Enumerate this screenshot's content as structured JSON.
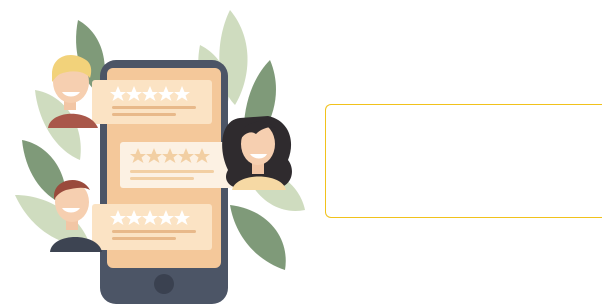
{
  "illustration": {
    "review_cards": [
      {
        "position": "top",
        "stars": 5,
        "reviewer": "blond-man"
      },
      {
        "position": "middle",
        "stars": 5,
        "reviewer": "curly-haired-woman"
      },
      {
        "position": "bottom",
        "stars": 5,
        "reviewer": "brown-haired-man"
      }
    ]
  },
  "colors": {
    "phone_body": "#4c5566",
    "screen": "#f4c89a",
    "card": "#fbe3c4",
    "card_middle": "#fcf1e3",
    "leaf_dark": "#7f9a79",
    "leaf_light": "#cfdcbf",
    "star": "#ffffff",
    "star_middle": "#f2cfa3",
    "box_border": "#f1c21b"
  },
  "empty_box": {}
}
